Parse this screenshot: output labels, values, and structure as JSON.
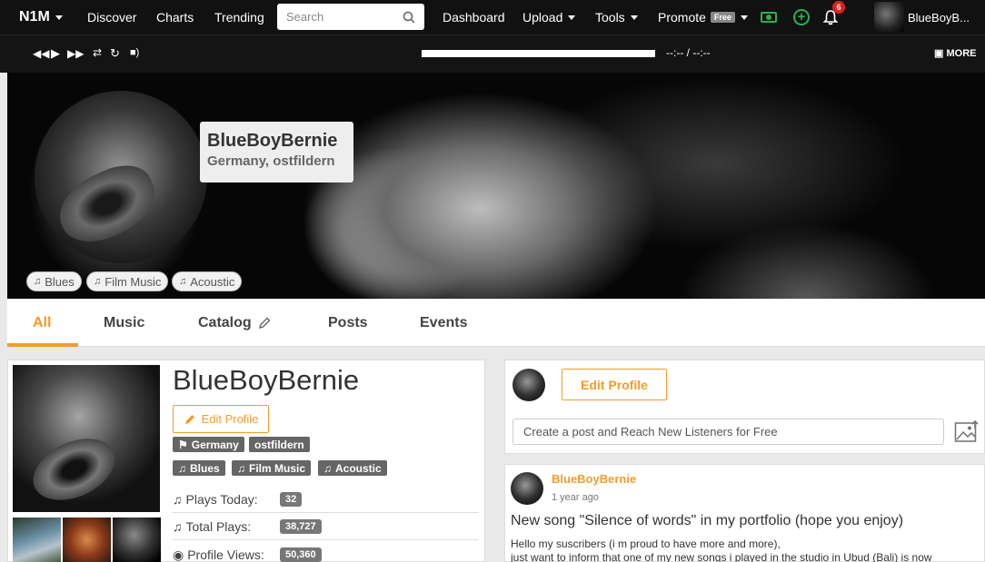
{
  "nav": {
    "brand": "N1M",
    "discover": "Discover",
    "charts": "Charts",
    "trending": "Trending",
    "search_placeholder": "Search",
    "dashboard": "Dashboard",
    "upload": "Upload",
    "tools": "Tools",
    "promote": "Promote",
    "promote_badge": "Free",
    "notification_count": "6",
    "user_name": "BlueBoyB..."
  },
  "player": {
    "time": "--:-- / --:--",
    "more": "MORE"
  },
  "banner": {
    "name": "BlueBoyBernie",
    "location": "Germany, ostfildern",
    "genres": [
      "Blues",
      "Film Music",
      "Acoustic"
    ]
  },
  "tabs": [
    "All",
    "Music",
    "Catalog",
    "Posts",
    "Events"
  ],
  "profile": {
    "name": "BlueBoyBernie",
    "edit_label": "Edit Profile",
    "country": "Germany",
    "city": "ostfildern",
    "genres": [
      "Blues",
      "Film Music",
      "Acoustic"
    ],
    "stats": [
      {
        "label": "Plays Today:",
        "value": "32"
      },
      {
        "label": "Total Plays:",
        "value": "38,727"
      },
      {
        "label": "Profile Views:",
        "value": "50,360"
      }
    ]
  },
  "composer": {
    "edit_label": "Edit Profile",
    "placeholder": "Create a post and Reach New Listeners for Free"
  },
  "post": {
    "author": "BlueBoyBernie",
    "time": "1 year ago",
    "title": "New song \"Silence of words\" in my portfolio (hope you enjoy)",
    "line1": "Hello my suscribers (i m proud to have more and more),",
    "line2": "just want to inform that one of my new songs i played in the studio in Ubud (Bali) is now"
  },
  "colors": {
    "accent": "#f59c2a",
    "nav_bg": "#111111",
    "green": "#2bb24c",
    "badge_red": "#e02020"
  }
}
